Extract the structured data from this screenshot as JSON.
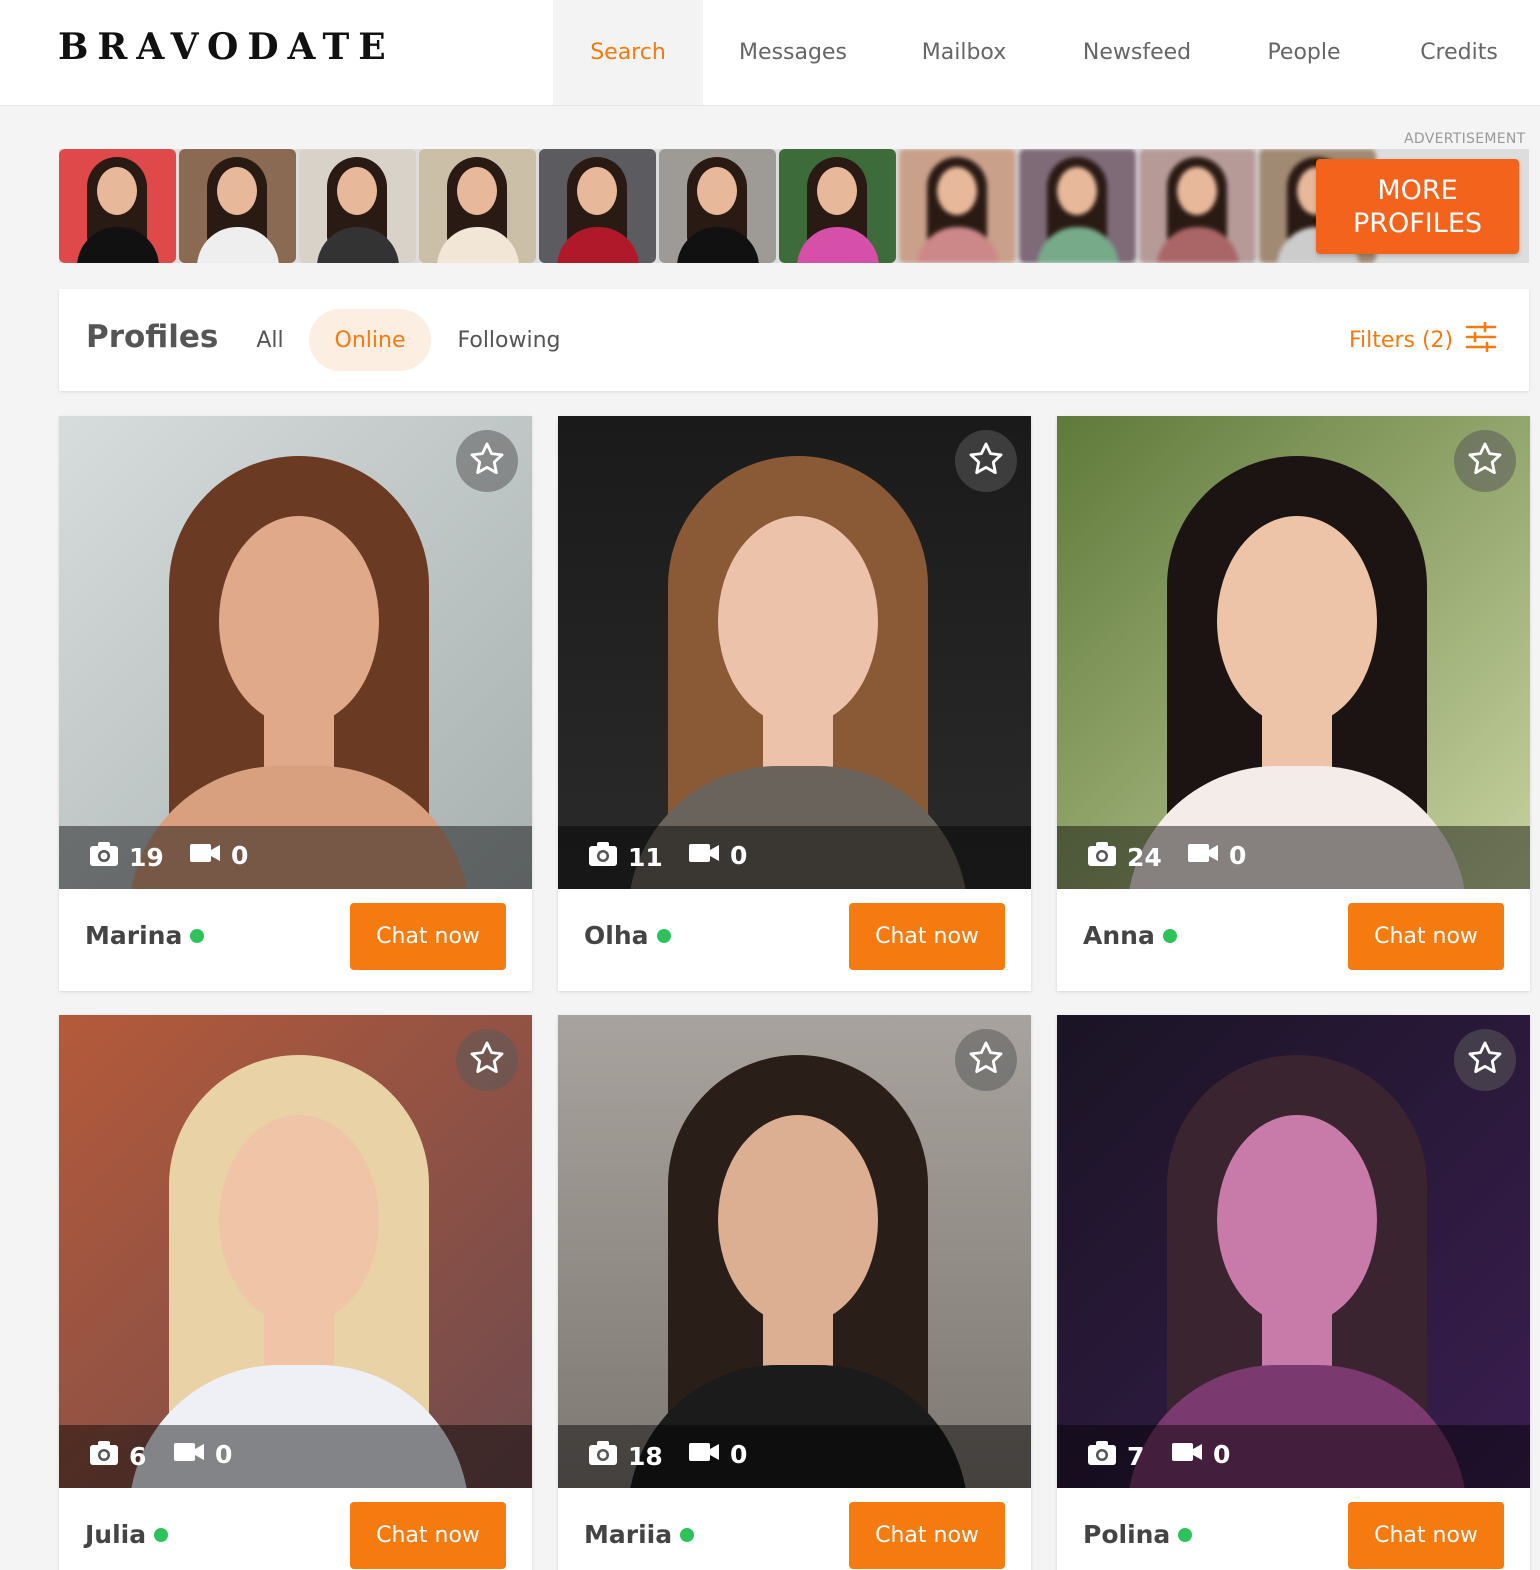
{
  "header": {
    "logo": "BRAVODATE",
    "nav": [
      {
        "label": "Search",
        "active": true
      },
      {
        "label": "Messages"
      },
      {
        "label": "Mailbox"
      },
      {
        "label": "Newsfeed"
      },
      {
        "label": "People"
      },
      {
        "label": "Credits"
      }
    ]
  },
  "ad": {
    "label": "ADVERTISEMENT",
    "more_button": "MORE PROFILES",
    "thumb_count": 11
  },
  "profiles": {
    "title": "Profiles",
    "tabs": [
      "All",
      "Online",
      "Following"
    ],
    "active_tab": "Online",
    "filters_label": "Filters (2)"
  },
  "colors": {
    "accent": "#f57a0f",
    "online": "#2ec25b",
    "ad_button": "#f4631c"
  },
  "cards": [
    {
      "name": "Marina",
      "photos": "19",
      "videos": "0",
      "online": true,
      "chat_label": "Chat now",
      "icon": "star-icon"
    },
    {
      "name": "Olha",
      "photos": "11",
      "videos": "0",
      "online": true,
      "chat_label": "Chat now",
      "icon": "star-icon"
    },
    {
      "name": "Anna",
      "photos": "24",
      "videos": "0",
      "online": true,
      "chat_label": "Chat now",
      "icon": "star-icon"
    },
    {
      "name": "Julia",
      "photos": "6",
      "videos": "0",
      "online": true,
      "chat_label": "Chat now",
      "icon": "star-icon"
    },
    {
      "name": "Mariia",
      "photos": "18",
      "videos": "0",
      "online": true,
      "chat_label": "Chat now",
      "icon": "star-icon"
    },
    {
      "name": "Polina",
      "photos": "7",
      "videos": "0",
      "online": true,
      "chat_label": "Chat now",
      "icon": "star-icon"
    }
  ]
}
